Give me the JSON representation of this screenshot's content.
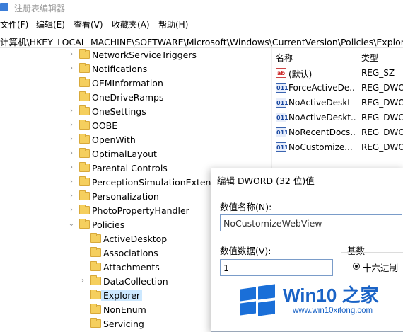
{
  "window": {
    "title": "注册表编辑器"
  },
  "menu": [
    "文件(F)",
    "编辑(E)",
    "查看(V)",
    "收藏夹(A)",
    "帮助(H)"
  ],
  "address": "计算机\\HKEY_LOCAL_MACHINE\\SOFTWARE\\Microsoft\\Windows\\CurrentVersion\\Policies\\Explorer",
  "tree": [
    {
      "label": "NetworkServiceTriggers"
    },
    {
      "label": "Notifications"
    },
    {
      "label": "OEMInformation"
    },
    {
      "label": "OneDriveRamps"
    },
    {
      "label": "OneSettings"
    },
    {
      "label": "OOBE"
    },
    {
      "label": "OpenWith"
    },
    {
      "label": "OptimalLayout"
    },
    {
      "label": "Parental Controls"
    },
    {
      "label": "PerceptionSimulationExtensio"
    },
    {
      "label": "Personalization"
    },
    {
      "label": "PhotoPropertyHandler"
    },
    {
      "label": "Policies"
    },
    {
      "label": "ActiveDesktop"
    },
    {
      "label": "Associations"
    },
    {
      "label": "Attachments"
    },
    {
      "label": "DataCollection"
    },
    {
      "label": "Explorer"
    },
    {
      "label": "NonEnum"
    },
    {
      "label": "Servicing"
    }
  ],
  "list": {
    "headers": {
      "name": "名称",
      "type": "类型"
    },
    "rows": [
      {
        "name": "(默认)",
        "type": "REG_SZ",
        "icon": "string-value-icon"
      },
      {
        "name": "ForceActiveDe...",
        "type": "REG_DWO",
        "icon": "dword-value-icon"
      },
      {
        "name": "NoActiveDeskt",
        "type": "REG_DWO",
        "icon": "dword-value-icon"
      },
      {
        "name": "NoActiveDeskt...",
        "type": "REG_DWO",
        "icon": "dword-value-icon"
      },
      {
        "name": "NoRecentDocs...",
        "type": "REG_DWO",
        "icon": "dword-value-icon"
      },
      {
        "name": "NoCustomize...",
        "type": "REG_DWO",
        "icon": "dword-value-icon"
      }
    ],
    "icon_text": {
      "string": "ab",
      "dword": "011"
    }
  },
  "dialog": {
    "title": "编辑 DWORD (32 位)值",
    "name_label": "数值名称(N):",
    "name_value": "NoCustomizeWebView",
    "data_label": "数值数据(V):",
    "data_value": "1",
    "base_label": "基数",
    "base_option": "十六进制"
  },
  "watermark": {
    "brand": "Win10 之家",
    "url": "www.win10xitong.com"
  }
}
